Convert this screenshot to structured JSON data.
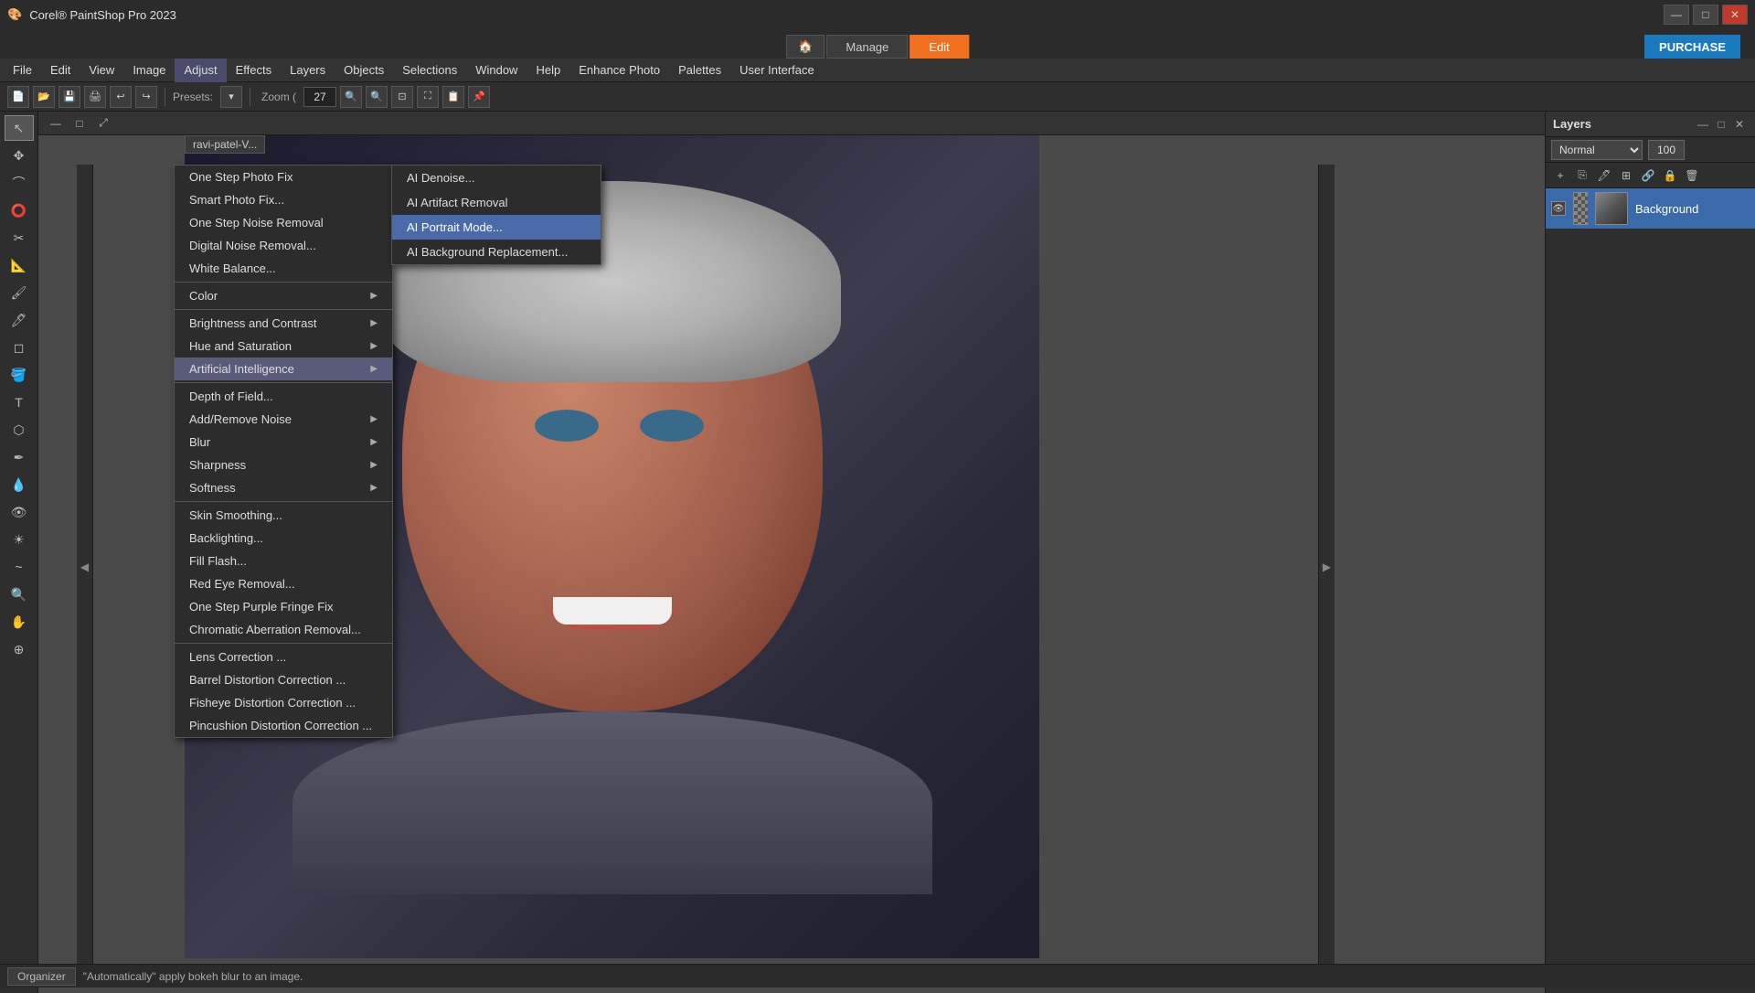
{
  "app": {
    "title": "Corel® PaintShop Pro 2023",
    "icon": "🎨"
  },
  "titlebar": {
    "title": "Corel® PaintShop Pro 2023",
    "minimize": "—",
    "maximize": "□",
    "close": "✕"
  },
  "centernav": {
    "home_icon": "🏠",
    "manage_label": "Manage",
    "edit_label": "Edit",
    "purchase_label": "PURCHASE"
  },
  "menubar": {
    "items": [
      {
        "id": "file",
        "label": "File"
      },
      {
        "id": "edit",
        "label": "Edit"
      },
      {
        "id": "view",
        "label": "View"
      },
      {
        "id": "image",
        "label": "Image"
      },
      {
        "id": "adjust",
        "label": "Adjust",
        "active": true
      },
      {
        "id": "effects",
        "label": "Effects"
      },
      {
        "id": "layers",
        "label": "Layers"
      },
      {
        "id": "objects",
        "label": "Objects"
      },
      {
        "id": "selections",
        "label": "Selections"
      },
      {
        "id": "window",
        "label": "Window"
      },
      {
        "id": "help",
        "label": "Help"
      },
      {
        "id": "enhance",
        "label": "Enhance Photo"
      },
      {
        "id": "palettes",
        "label": "Palettes"
      },
      {
        "id": "ui",
        "label": "User Interface"
      }
    ]
  },
  "toolbar": {
    "presets_label": "Presets:",
    "zoom_label": "Zoom (",
    "zoom_value": "27"
  },
  "adjust_menu": {
    "items": [
      {
        "id": "one-step-photo-fix",
        "label": "One Step Photo Fix",
        "has_arrow": false
      },
      {
        "id": "smart-photo-fix",
        "label": "Smart Photo Fix...",
        "has_arrow": false
      },
      {
        "id": "one-step-noise-removal",
        "label": "One Step Noise Removal",
        "has_arrow": false
      },
      {
        "id": "digital-noise-removal",
        "label": "Digital Noise Removal...",
        "has_arrow": false
      },
      {
        "id": "white-balance",
        "label": "White Balance...",
        "has_arrow": false
      },
      {
        "separator": true
      },
      {
        "id": "color",
        "label": "Color",
        "has_arrow": true
      },
      {
        "separator": false
      },
      {
        "id": "brightness-contrast",
        "label": "Brightness and Contrast",
        "has_arrow": true
      },
      {
        "id": "hue-saturation",
        "label": "Hue and Saturation",
        "has_arrow": true
      },
      {
        "id": "artificial-intelligence",
        "label": "Artificial Intelligence",
        "has_arrow": true,
        "active": true
      },
      {
        "separator": false
      },
      {
        "id": "depth-of-field",
        "label": "Depth of Field...",
        "has_arrow": false
      },
      {
        "id": "add-remove-noise",
        "label": "Add/Remove Noise",
        "has_arrow": true
      },
      {
        "id": "blur",
        "label": "Blur",
        "has_arrow": true
      },
      {
        "id": "sharpness",
        "label": "Sharpness",
        "has_arrow": true
      },
      {
        "id": "softness",
        "label": "Softness",
        "has_arrow": true
      },
      {
        "separator": true
      },
      {
        "id": "skin-smoothing",
        "label": "Skin Smoothing...",
        "has_arrow": false
      },
      {
        "id": "backlighting",
        "label": "Backlighting...",
        "has_arrow": false
      },
      {
        "id": "fill-flash",
        "label": "Fill Flash...",
        "has_arrow": false
      },
      {
        "id": "red-eye-removal",
        "label": "Red Eye Removal...",
        "has_arrow": false
      },
      {
        "id": "one-step-purple-fringe",
        "label": "One Step Purple Fringe Fix",
        "has_arrow": false
      },
      {
        "id": "chromatic-aberration",
        "label": "Chromatic Aberration Removal...",
        "has_arrow": false
      },
      {
        "separator": true
      },
      {
        "id": "lens-correction",
        "label": "Lens Correction ...",
        "has_arrow": false
      },
      {
        "id": "barrel-distortion",
        "label": "Barrel Distortion Correction ...",
        "has_arrow": false
      },
      {
        "id": "fisheye-distortion",
        "label": "Fisheye Distortion Correction ...",
        "has_arrow": false
      },
      {
        "id": "pincushion-distortion",
        "label": "Pincushion Distortion Correction ...",
        "has_arrow": false
      }
    ]
  },
  "ai_submenu": {
    "items": [
      {
        "id": "ai-denoise",
        "label": "AI Denoise..."
      },
      {
        "id": "ai-artifact-removal",
        "label": "AI Artifact Removal"
      },
      {
        "id": "ai-portrait-mode",
        "label": "AI Portrait Mode...",
        "selected": true
      },
      {
        "id": "ai-background-replacement",
        "label": "AI Background Replacement..."
      }
    ]
  },
  "layers": {
    "title": "Layers",
    "blend_mode": "Normal",
    "opacity": "100",
    "layer_name": "Background"
  },
  "bottom": {
    "organizer_label": "Organizer",
    "status_text": "\"Automatically\" apply bokeh blur to an image."
  }
}
